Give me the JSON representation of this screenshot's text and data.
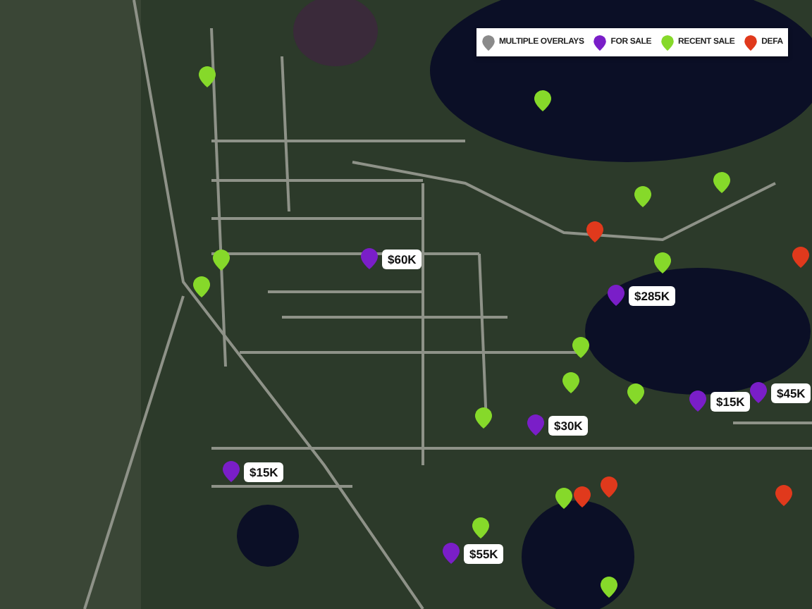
{
  "legend": [
    {
      "kind": "multiple",
      "label": "MULTIPLE OVERLAYS"
    },
    {
      "kind": "for_sale",
      "label": "FOR SALE"
    },
    {
      "kind": "recent_sale",
      "label": "RECENT SALE"
    },
    {
      "kind": "default",
      "label": "DEFA"
    }
  ],
  "pins": [
    {
      "kind": "recent_sale"
    },
    {
      "kind": "recent_sale"
    },
    {
      "kind": "recent_sale"
    },
    {
      "kind": "recent_sale"
    },
    {
      "kind": "default"
    },
    {
      "kind": "recent_sale"
    },
    {
      "kind": "default"
    },
    {
      "kind": "for_sale",
      "price": "$60K"
    },
    {
      "kind": "recent_sale"
    },
    {
      "kind": "recent_sale"
    },
    {
      "kind": "for_sale",
      "price": "$285K"
    },
    {
      "kind": "recent_sale"
    },
    {
      "kind": "recent_sale"
    },
    {
      "kind": "recent_sale"
    },
    {
      "kind": "for_sale",
      "price": "$15K"
    },
    {
      "kind": "for_sale",
      "price": "$45K"
    },
    {
      "kind": "recent_sale"
    },
    {
      "kind": "for_sale",
      "price": "$30K"
    },
    {
      "kind": "for_sale",
      "price": "$15K"
    },
    {
      "kind": "recent_sale"
    },
    {
      "kind": "default"
    },
    {
      "kind": "default"
    },
    {
      "kind": "recent_sale"
    },
    {
      "kind": "for_sale",
      "price": "$55K"
    },
    {
      "kind": "recent_sale"
    },
    {
      "kind": "default"
    }
  ]
}
